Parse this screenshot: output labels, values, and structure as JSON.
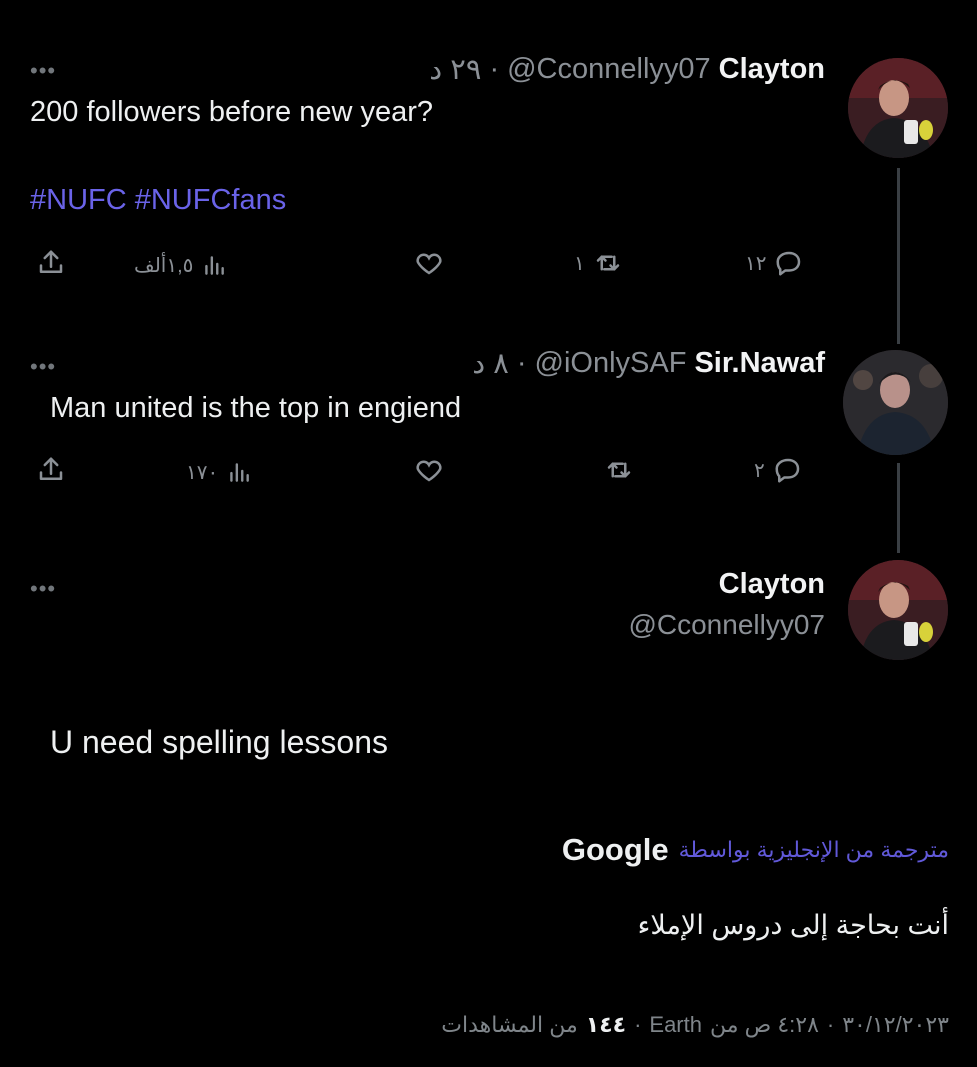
{
  "colors": {
    "background": "#000000",
    "link": "#6a63e8",
    "muted": "#8b9096",
    "text": "#e7e9ea"
  },
  "tweet1": {
    "more": "•••",
    "name": "Clayton",
    "handle": "@Cconnellyy07",
    "sep": "·",
    "ago": "٢٩ د",
    "text": "200 followers before new year?",
    "hashtags": "#NUFC #NUFCfans",
    "views": "١,٥ألف",
    "likes": "",
    "reposts": "١",
    "replies": "١٢"
  },
  "tweet2": {
    "more": "•••",
    "name": "Sir.Nawaf",
    "handle": "@iOnlySAF",
    "sep": "·",
    "ago": "٨ د",
    "text": "Man united is the top in engiend",
    "views": "١٧٠",
    "likes": "",
    "reposts": "",
    "replies": "٢"
  },
  "tweet3": {
    "more": "•••",
    "name": "Clayton",
    "handle": "@Cconnellyy07",
    "text": "U need spelling lessons",
    "translation_label": "مترجمة من الإنجليزية بواسطة",
    "translation_provider": "Google",
    "translated_text": "أنت بحاجة إلى دروس الإملاء",
    "meta_date": "٣٠/١٢/٢٠٢٣",
    "meta_time": "٤:٢٨ ص من",
    "meta_location": "Earth",
    "meta_views_count": "١٤٤",
    "meta_views_label": "من المشاهدات"
  }
}
